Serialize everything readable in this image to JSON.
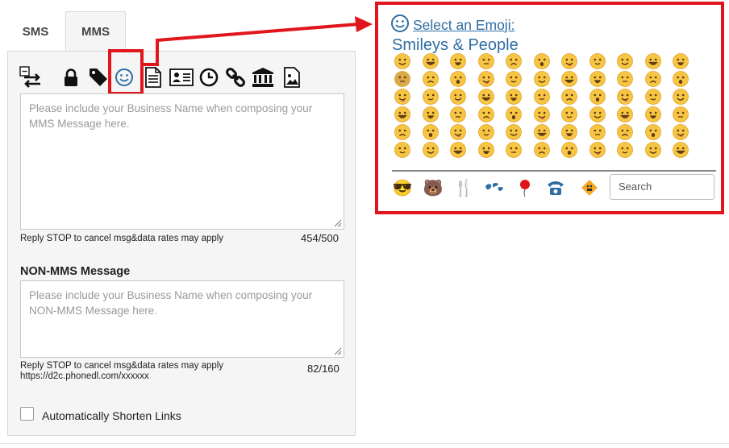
{
  "tabs": [
    {
      "label": "SMS",
      "active": false
    },
    {
      "label": "MMS",
      "active": true
    }
  ],
  "toolbar": {
    "icons": [
      "collapse-swap-icon",
      "lock-icon",
      "tag-icon",
      "smiley-icon",
      "document-icon",
      "contact-card-icon",
      "clock-icon",
      "link-icon",
      "bank-icon",
      "image-icon"
    ]
  },
  "mms": {
    "placeholder": "Please include your Business Name when composing your MMS Message here.",
    "disclaimer": "Reply STOP to cancel msg&data rates may apply",
    "count": "454/500"
  },
  "non_mms": {
    "title": "NON-MMS Message",
    "placeholder": "Please include your Business Name when composing your NON-MMS Message here.",
    "disclaimer": "Reply STOP to cancel msg&data rates may apply",
    "link": "https://d2c.phonedl.com/xxxxxx",
    "count": "82/160"
  },
  "shorten": {
    "label": "Automatically Shorten Links",
    "checked": false
  },
  "emoji_popup": {
    "title": "Select an Emoji:",
    "category_name": "Smileys & People",
    "search_placeholder": "Search",
    "categories": [
      "smileys-people-icon",
      "animals-nature-icon",
      "food-drink-icon",
      "travel-places-icon",
      "activities-icon",
      "objects-icon",
      "symbols-icon"
    ]
  },
  "colors": {
    "accent_red": "#e0161c",
    "link_blue": "#2f6ea3",
    "emoji_yellow": "#f7c544"
  }
}
